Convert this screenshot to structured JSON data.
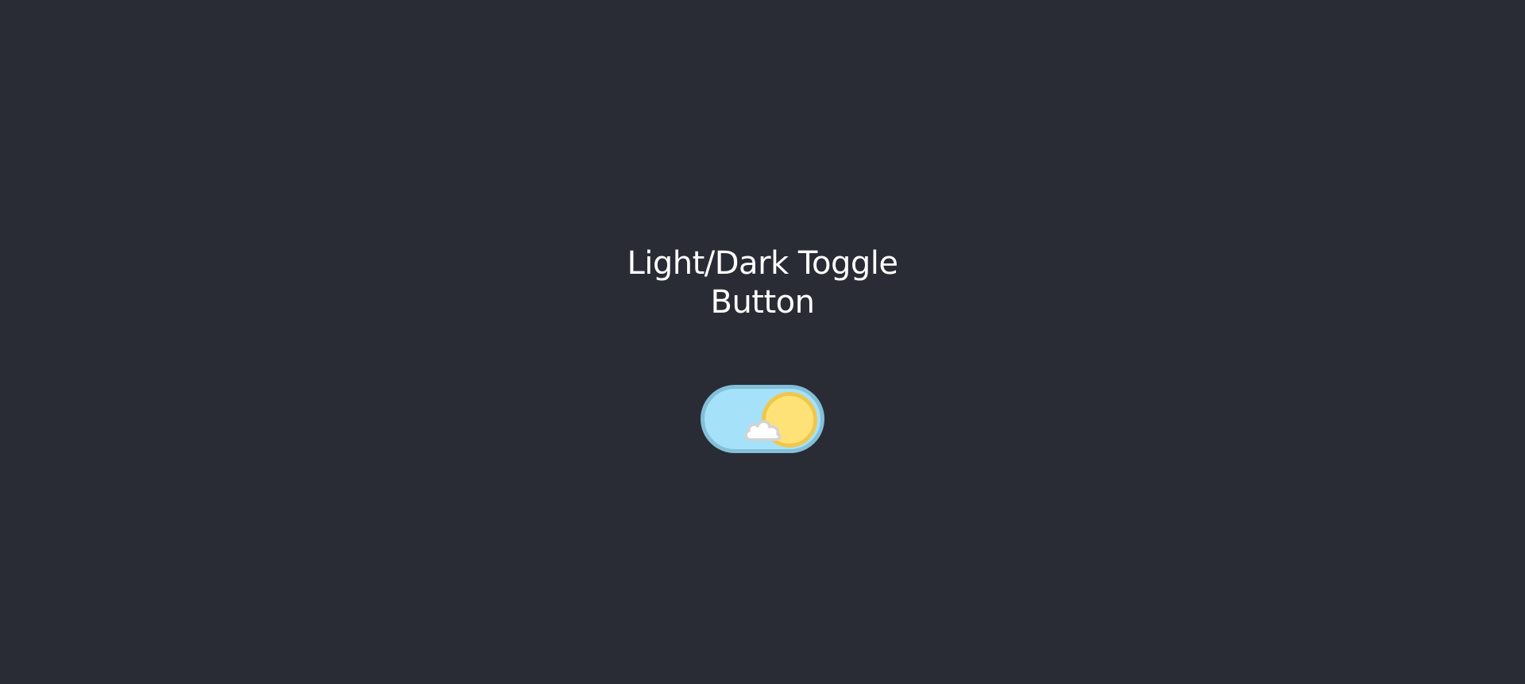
{
  "page": {
    "title_line1": "Light/Dark",
    "title_line2_prefix": "Toggle",
    "title_line2": "Button"
  },
  "toggle": {
    "state": "light",
    "checked": false,
    "aria_label": "Light/Dark Toggle"
  },
  "colors": {
    "background": "#2a2c35",
    "title": "#ffffff",
    "track": "#a5e2fa",
    "track_border": "#84bfd8",
    "sun": "#ffe277",
    "sun_border": "#f0c74d",
    "cloud": "#ffffff",
    "cloud_border": "#d3d3d3"
  },
  "icons": {
    "sun": "sun-icon",
    "cloud": "cloud-icon"
  }
}
